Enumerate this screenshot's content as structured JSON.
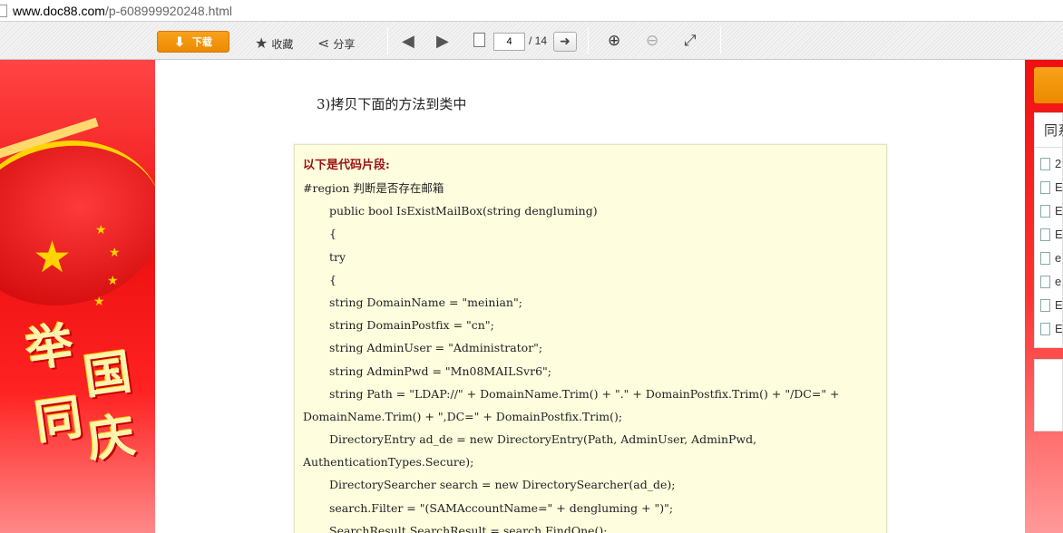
{
  "browser": {
    "url_host": "www.doc88.com",
    "url_path": "/p-608999920248.html"
  },
  "toolbar": {
    "download_label": "下载",
    "favorite_label": "收藏",
    "share_label": "分享",
    "current_page": "4",
    "total_pages": "/ 14"
  },
  "icons": {
    "download": "download-arrow-icon",
    "favorite": "star-icon",
    "share": "share-icon",
    "prev": "arrow-left-icon",
    "next": "arrow-right-icon",
    "page": "page-icon",
    "go": "go-arrow-icon",
    "zoom_in": "zoom-in-icon",
    "zoom_out": "zoom-out-icon",
    "fullscreen": "fullscreen-icon"
  },
  "banner": {
    "slogan_chars": [
      "举",
      "国",
      "同",
      "庆"
    ]
  },
  "document": {
    "step": "3)拷贝下面的方法到类中",
    "code_header": "以下是代码片段:",
    "code_lines": [
      {
        "text": "#region 判断是否存在邮箱",
        "indent": false
      },
      {
        "text": "public bool IsExistMailBox(string dengluming)",
        "indent": true
      },
      {
        "text": "{",
        "indent": true
      },
      {
        "text": "try",
        "indent": true
      },
      {
        "text": "{",
        "indent": true
      },
      {
        "text": "string DomainName = \"meinian\";",
        "indent": true
      },
      {
        "text": "string DomainPostfix = \"cn\";",
        "indent": true
      },
      {
        "text": "string AdminUser = \"Administrator\";",
        "indent": true
      },
      {
        "text": "string AdminPwd = \"Mn08MAILSvr6\";",
        "indent": true
      },
      {
        "text": "string Path = \"LDAP://\" + DomainName.Trim() + \".\" + DomainPostfix.Trim() + \"/DC=\" +",
        "indent": true
      },
      {
        "text": "DomainName.Trim() + \",DC=\" + DomainPostfix.Trim();",
        "indent": false
      },
      {
        "text": "DirectoryEntry ad_de = new DirectoryEntry(Path, AdminUser, AdminPwd,",
        "indent": true
      },
      {
        "text": "AuthenticationTypes.Secure);",
        "indent": false
      },
      {
        "text": "DirectorySearcher search = new DirectorySearcher(ad_de);",
        "indent": true
      },
      {
        "text": "search.Filter = \"(SAMAccountName=\" + dengluming + \")\";",
        "indent": true
      },
      {
        "text": "SearchResult SearchResult = search.FindOne();",
        "indent": true
      }
    ]
  },
  "sidebar": {
    "title": "同系",
    "items": [
      "2",
      "E",
      "E",
      "E",
      "e",
      "e",
      "E",
      "E"
    ]
  }
}
